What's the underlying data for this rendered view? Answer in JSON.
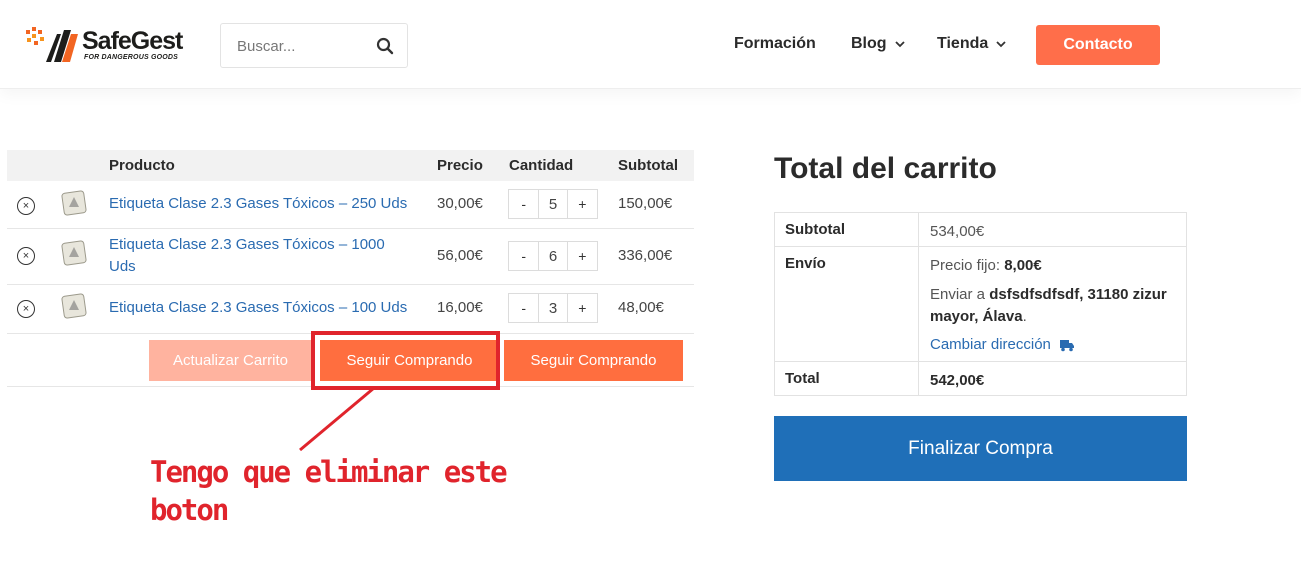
{
  "header": {
    "logo_text": "SafeGest",
    "logo_sub": "FOR DANGEROUS GOODS",
    "search_placeholder": "Buscar...",
    "nav": [
      {
        "label": "Formación"
      },
      {
        "label": "Blog"
      },
      {
        "label": "Tienda"
      }
    ],
    "contact_label": "Contacto"
  },
  "cart": {
    "headers": {
      "product": "Producto",
      "price": "Precio",
      "quantity": "Cantidad",
      "subtotal": "Subtotal"
    },
    "items": [
      {
        "name": "Etiqueta Clase 2.3 Gases Tóxicos – 250 Uds",
        "price": "30,00€",
        "qty": "5",
        "subtotal": "150,00€"
      },
      {
        "name": "Etiqueta Clase 2.3 Gases Tóxicos – 1000 Uds",
        "price": "56,00€",
        "qty": "6",
        "subtotal": "336,00€"
      },
      {
        "name": "Etiqueta Clase 2.3 Gases Tóxicos – 100 Uds",
        "price": "16,00€",
        "qty": "3",
        "subtotal": "48,00€"
      }
    ],
    "qty_minus": "-",
    "qty_plus": "+",
    "remove_symbol": "×",
    "update_label": "Actualizar Carrito",
    "continue_label_1": "Seguir Comprando",
    "continue_label_2": "Seguir Comprando"
  },
  "annotation": {
    "text": "Tengo que eliminar este boton",
    "color": "#e0242c"
  },
  "totals": {
    "title": "Total del carrito",
    "subtotal_label": "Subtotal",
    "subtotal_value": "534,00€",
    "shipping_label": "Envío",
    "shipping_fixed_prefix": "Precio fijo:",
    "shipping_fixed_value": "8,00€",
    "ship_to_prefix": "Enviar a",
    "ship_to_address": "dsfsdfsdfsdf, 31180 zizur mayor, Álava",
    "ship_to_suffix": ".",
    "change_address": "Cambiar dirección",
    "total_label": "Total",
    "total_value": "542,00€",
    "checkout_label": "Finalizar Compra"
  },
  "colors": {
    "accent": "#ff6e4a",
    "link": "#2a6bb1",
    "checkout": "#1f6fb8"
  }
}
